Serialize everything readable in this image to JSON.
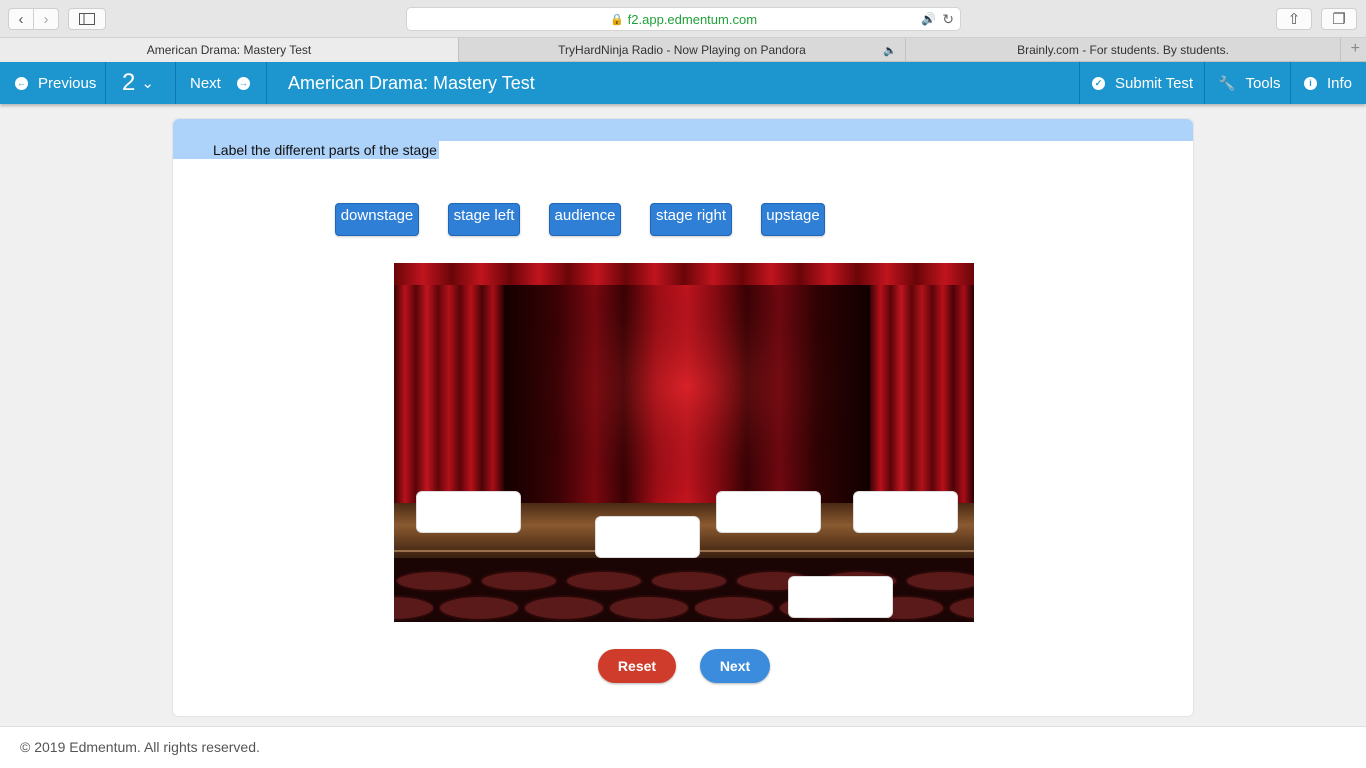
{
  "browser": {
    "url": "f2.app.edmentum.com",
    "tabs": [
      {
        "label": "American Drama: Mastery Test"
      },
      {
        "label": "TryHardNinja Radio - Now Playing on Pandora"
      },
      {
        "label": "Brainly.com - For students. By students."
      }
    ]
  },
  "toolbar": {
    "previous_label": "Previous",
    "question_number": "2",
    "next_label": "Next",
    "title": "American Drama: Mastery Test",
    "submit_label": "Submit Test",
    "tools_label": "Tools",
    "info_label": "Info"
  },
  "question": {
    "prompt": "Label the different parts of the stage",
    "options": [
      {
        "label": "downstage"
      },
      {
        "label": "stage left"
      },
      {
        "label": "audience"
      },
      {
        "label": "stage right"
      },
      {
        "label": "upstage"
      }
    ],
    "reset_label": "Reset",
    "next_label": "Next"
  },
  "footer": {
    "copyright": "© 2019 Edmentum. All rights reserved."
  },
  "colors": {
    "toolbar": "#1d96d0",
    "chip": "#2f7fd6",
    "reset": "#cf3c2b",
    "next": "#3b8cdd",
    "prompt_highlight": "#aed3fb"
  }
}
